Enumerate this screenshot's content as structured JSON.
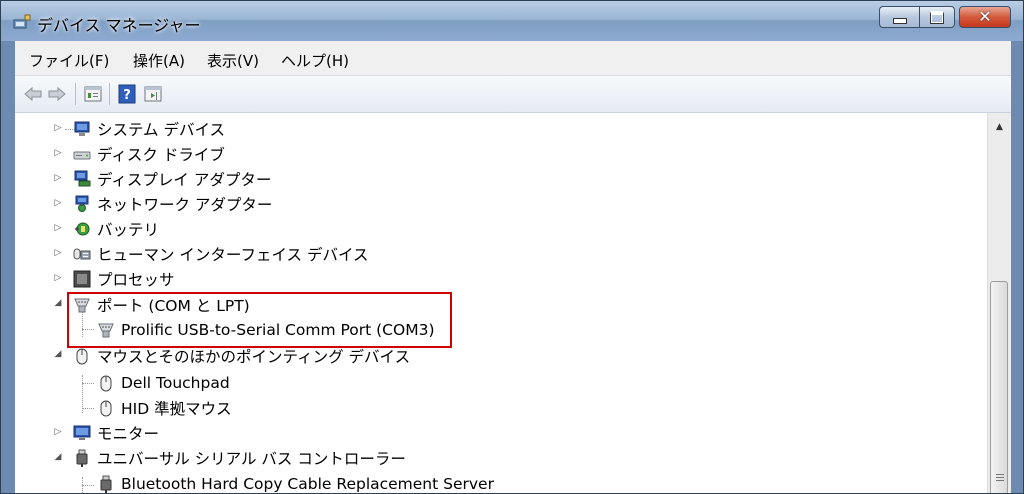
{
  "window": {
    "title": "デバイス マネージャー",
    "close_glyph": "✕"
  },
  "menu": [
    {
      "label": "ファイル(F)"
    },
    {
      "label": "操作(A)"
    },
    {
      "label": "表示(V)"
    },
    {
      "label": "ヘルプ(H)"
    }
  ],
  "toolbar": {
    "icons": [
      "back-arrow-icon",
      "forward-arrow-icon",
      "properties-icon",
      "help-icon",
      "action-pane-icon"
    ]
  },
  "tree": {
    "items": [
      {
        "label": "システム デバイス",
        "icon": "system-device-icon",
        "expander": "▷"
      },
      {
        "label": "ディスク ドライブ",
        "icon": "disk-drive-icon",
        "expander": "▷"
      },
      {
        "label": "ディスプレイ アダプター",
        "icon": "display-adapter-icon",
        "expander": "▷"
      },
      {
        "label": "ネットワーク アダプター",
        "icon": "network-adapter-icon",
        "expander": "▷"
      },
      {
        "label": "バッテリ",
        "icon": "battery-icon",
        "expander": "▷"
      },
      {
        "label": "ヒューマン インターフェイス デバイス",
        "icon": "hid-icon",
        "expander": "▷"
      },
      {
        "label": "プロセッサ",
        "icon": "processor-icon",
        "expander": "▷"
      },
      {
        "label": "ポート (COM と LPT)",
        "icon": "port-icon",
        "expander": "◢"
      },
      {
        "label": "Prolific USB-to-Serial Comm Port (COM3)",
        "icon": "port-icon"
      },
      {
        "label": "マウスとそのほかのポインティング デバイス",
        "icon": "mouse-icon",
        "expander": "◢"
      },
      {
        "label": "Dell Touchpad",
        "icon": "mouse-icon"
      },
      {
        "label": "HID 準拠マウス",
        "icon": "mouse-icon"
      },
      {
        "label": "モニター",
        "icon": "monitor-icon",
        "expander": "▷"
      },
      {
        "label": "ユニバーサル シリアル バス コントローラー",
        "icon": "usb-icon",
        "expander": "◢"
      },
      {
        "label": "Bluetooth Hard Copy Cable Replacement Server",
        "icon": "usb-icon"
      }
    ]
  },
  "colors": {
    "highlight": "#d00000",
    "titlebar": "#9bb6d5",
    "close_button": "#c4371c"
  },
  "scrollbar": {
    "up_arrow": "▲"
  }
}
